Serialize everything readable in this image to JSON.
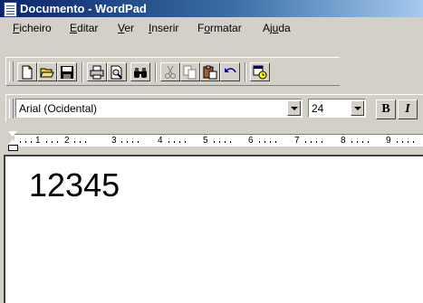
{
  "window": {
    "title": "Documento - WordPad"
  },
  "menu": [
    {
      "pre": "",
      "acc": "F",
      "post": "icheiro"
    },
    {
      "pre": "",
      "acc": "E",
      "post": "ditar"
    },
    {
      "pre": "",
      "acc": "V",
      "post": "er"
    },
    {
      "pre": "",
      "acc": "I",
      "post": "nserir"
    },
    {
      "pre": "F",
      "acc": "o",
      "post": "rmatar"
    },
    {
      "pre": "Aj",
      "acc": "u",
      "post": "da"
    }
  ],
  "toolbar": {
    "buttons": [
      "new-icon",
      "open-icon",
      "save-icon",
      "print-icon",
      "print-preview-icon",
      "find-icon",
      "cut-icon",
      "copy-icon",
      "paste-icon",
      "undo-icon",
      "date-time-icon"
    ]
  },
  "format": {
    "font": "Arial (Ocidental)",
    "size": "24",
    "bold_label": "B",
    "italic_label": "I"
  },
  "ruler": {
    "labels": [
      "1",
      "2",
      "3",
      "4",
      "5",
      "6",
      "7",
      "8",
      "9"
    ]
  },
  "document": {
    "text": "12345"
  }
}
